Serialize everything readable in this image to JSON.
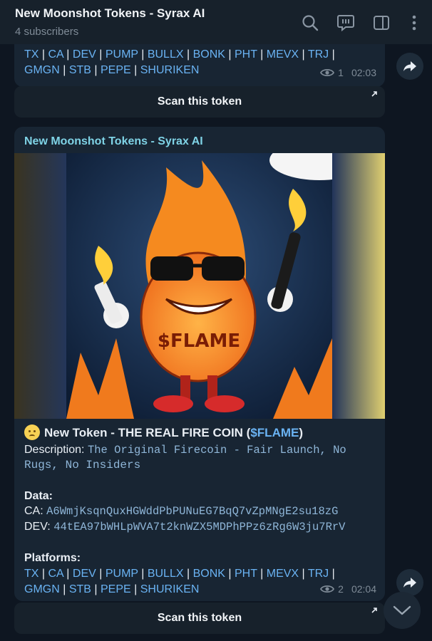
{
  "header": {
    "title": "New Moonshot Tokens - Syrax AI",
    "subscribers": "4 subscribers"
  },
  "top_message": {
    "platform_links_row1": [
      "TX",
      "CA",
      "DEV",
      "PUMP",
      "BULLX",
      "BONK",
      "PHT",
      "MEVX",
      "TRJ"
    ],
    "platform_links_row2": [
      "GMGN",
      "STB",
      "PEPE",
      "SHURIKEN"
    ],
    "views": "1",
    "time": "02:03",
    "scan_button": "Scan this token"
  },
  "main_message": {
    "channel_name": "New Moonshot Tokens - Syrax AI",
    "image_text": "$FLAME",
    "emoji": "🙁",
    "title_prefix": "New Token - THE REAL FIRE COIN (",
    "ticker": "$FLAME",
    "title_suffix": ")",
    "description_label": "Description:",
    "description_line1": "The Original Firecoin - Fair Launch, No",
    "description_line2": "Rugs, No Insiders",
    "data_label": "Data:",
    "ca_label": "CA:",
    "ca_value": "A6WmjKsqnQuxHGWddPbPUNuEG7BqQ7vZpMNgE2su18zG",
    "dev_label": "DEV:",
    "dev_value": "44tEA97bWHLpWVA7t2knWZX5MDPhPPz6zRg6W3ju7RrV",
    "platforms_label": "Platforms:",
    "platform_links_row1": [
      "TX",
      "CA",
      "DEV",
      "PUMP",
      "BULLX",
      "BONK",
      "PHT",
      "MEVX",
      "TRJ"
    ],
    "platform_links_row2": [
      "GMGN",
      "STB",
      "PEPE",
      "SHURIKEN"
    ],
    "views": "2",
    "time": "02:04",
    "scan_button": "Scan this token"
  },
  "colors": {
    "background": "#0e1621",
    "bubble": "#182533",
    "link": "#6ab3f3",
    "channel": "#7fd3e6"
  },
  "icons": [
    "search-icon",
    "comments-icon",
    "sidebar-toggle-icon",
    "more-vert-icon",
    "share-icon",
    "eye-icon",
    "external-arrow-icon",
    "chevron-down-icon"
  ]
}
